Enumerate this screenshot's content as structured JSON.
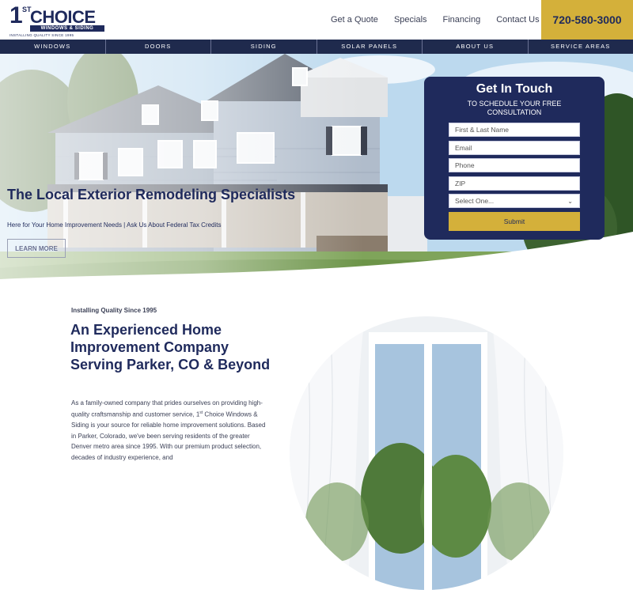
{
  "header": {
    "logo": {
      "big": "1",
      "superscript": "ST",
      "name": "CHOICE",
      "subtitle": "WINDOWS & SIDING",
      "tagline": "INSTALLING QUALITY SINCE 1995"
    },
    "links": [
      "Get a Quote",
      "Specials",
      "Financing",
      "Contact Us"
    ],
    "phone": "720-580-3000"
  },
  "mainnav": [
    "WINDOWS",
    "DOORS",
    "SIDING",
    "SOLAR PANELS",
    "ABOUT US",
    "SERVICE AREAS"
  ],
  "hero": {
    "title": "The Local Exterior Remodeling Specialists",
    "tagline": "Here for Your Home Improvement Needs | Ask Us About Federal Tax Credits",
    "button": "LEARN MORE"
  },
  "form": {
    "title": "Get In Touch",
    "subtitle": "TO SCHEDULE YOUR FREE CONSULTATION",
    "fields": [
      {
        "placeholder": "First & Last Name"
      },
      {
        "placeholder": "Email"
      },
      {
        "placeholder": "Phone"
      },
      {
        "placeholder": "ZIP"
      }
    ],
    "select": "Select One...",
    "submit": "Submit"
  },
  "content": {
    "eyebrow": "Installing Quality Since 1995",
    "heading": "An Experienced Home Improvement Company Serving Parker, CO & Beyond",
    "para_before_sup": "As a family-owned company that prides ourselves on providing high-quality craftsmanship and customer service, 1",
    "para_sup": "st",
    "para_after_sup": " Choice Windows & Siding is your source for reliable home improvement solutions. Based in Parker, Colorado, we've been serving residents of the greater Denver metro area since 1995. With our premium product selection, decades of industry experience, and"
  },
  "colors": {
    "navy": "#1f2a5c",
    "gold": "#d4b03a"
  }
}
